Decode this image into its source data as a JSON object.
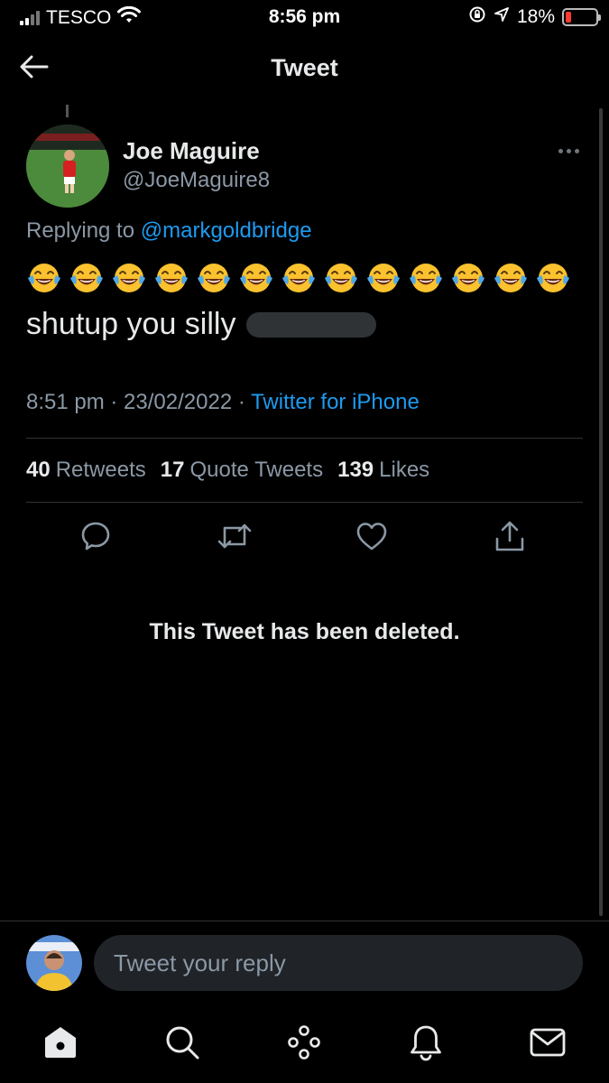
{
  "status_bar": {
    "carrier": "TESCO",
    "time": "8:56 pm",
    "battery_percent": "18%",
    "battery_level": 0.18,
    "battery_color": "#ff3b30"
  },
  "header": {
    "back_icon": "arrow-left-icon",
    "title": "Tweet"
  },
  "tweet": {
    "author_name": "Joe Maguire",
    "author_handle": "@JoeMaguire8",
    "more_icon": "more-horizontal-icon",
    "replying_prefix": "Replying to",
    "replying_to": "@markgoldbridge",
    "emoji": "😂",
    "emoji_count": 13,
    "text": "shutup you silly",
    "timestamp": "8:51 pm · 23/02/2022 ·",
    "source": "Twitter for iPhone",
    "stats": [
      {
        "count": "40",
        "label": "Retweets"
      },
      {
        "count": "17",
        "label": "Quote Tweets"
      },
      {
        "count": "139",
        "label": "Likes"
      }
    ],
    "actions": [
      "reply-icon",
      "retweet-icon",
      "like-icon",
      "share-icon"
    ]
  },
  "deleted_notice": "This Tweet has been deleted.",
  "composer": {
    "placeholder": "Tweet your reply"
  },
  "bottom_nav": [
    "home-icon",
    "search-icon",
    "spaces-icon",
    "notifications-icon",
    "messages-icon"
  ],
  "colors": {
    "background": "#000000",
    "accent": "#1d9bf0",
    "secondary_text": "#8b98a5",
    "divider": "#2f3336"
  }
}
